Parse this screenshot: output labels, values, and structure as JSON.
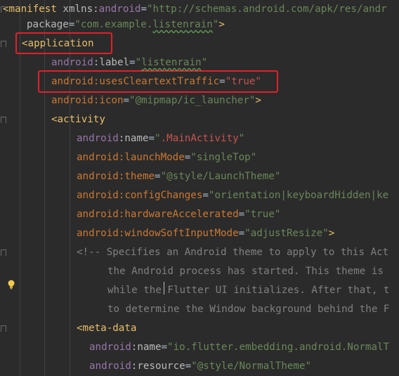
{
  "lines": [
    {
      "id": "l0",
      "parts": [
        [
          "tag",
          "<manifest "
        ],
        [
          "attr",
          "xmlns:"
        ],
        [
          "ns",
          "android"
        ],
        [
          "plain",
          "="
        ],
        [
          "val",
          "\"http://schemas.android.com/apk/res/andr"
        ]
      ]
    },
    {
      "id": "l1",
      "parts": [
        [
          "attr",
          "package"
        ],
        [
          "plain",
          "="
        ],
        [
          "val",
          "\"com.example."
        ],
        [
          "valu",
          "listenrain"
        ],
        [
          "val",
          "\""
        ],
        [
          "tag",
          ">"
        ]
      ]
    },
    {
      "id": "l2",
      "parts": [
        [
          "tag",
          "<application"
        ]
      ]
    },
    {
      "id": "l3",
      "parts": [
        [
          "ns",
          "android"
        ],
        [
          "attr",
          ":label"
        ],
        [
          "plain",
          "="
        ],
        [
          "val",
          "\""
        ],
        [
          "valu",
          "listenrain"
        ],
        [
          "val",
          "\""
        ]
      ]
    },
    {
      "id": "l4",
      "parts": [
        [
          "attrr",
          "android:usesCleartextTraffic"
        ],
        [
          "plain",
          "="
        ],
        [
          "valr",
          "\"true\""
        ]
      ]
    },
    {
      "id": "l5",
      "parts": [
        [
          "attrr",
          "android:icon"
        ],
        [
          "plain",
          "="
        ],
        [
          "val",
          "\"@mipmap/ic_launcher\""
        ],
        [
          "tag",
          ">"
        ]
      ]
    },
    {
      "id": "l6",
      "parts": [
        [
          "tag",
          "<activity"
        ]
      ]
    },
    {
      "id": "l7",
      "parts": [
        [
          "ns",
          "android"
        ],
        [
          "attr",
          ":name"
        ],
        [
          "plain",
          "="
        ],
        [
          "val",
          "\""
        ],
        [
          "valr",
          ".MainActivity"
        ],
        [
          "val",
          "\""
        ]
      ]
    },
    {
      "id": "l8",
      "parts": [
        [
          "attrr",
          "android:launchMode"
        ],
        [
          "plain",
          "="
        ],
        [
          "val",
          "\"singleTop\""
        ]
      ]
    },
    {
      "id": "l9",
      "parts": [
        [
          "attrr",
          "android:theme"
        ],
        [
          "plain",
          "="
        ],
        [
          "val",
          "\"@style/LaunchTheme\""
        ]
      ]
    },
    {
      "id": "l10",
      "parts": [
        [
          "attrr",
          "android:configChanges"
        ],
        [
          "plain",
          "="
        ],
        [
          "val",
          "\"orientation|keyboardHidden|ke"
        ]
      ]
    },
    {
      "id": "l11",
      "parts": [
        [
          "attrr",
          "android:hardwareAccelerated"
        ],
        [
          "plain",
          "="
        ],
        [
          "val",
          "\"true\""
        ]
      ]
    },
    {
      "id": "l12",
      "parts": [
        [
          "attrr",
          "android:windowSoftInputMode"
        ],
        [
          "plain",
          "="
        ],
        [
          "val",
          "\"adjustResize\""
        ],
        [
          "tag",
          ">"
        ]
      ]
    },
    {
      "id": "l13",
      "parts": [
        [
          "comment",
          "<!-- Specifies an Android theme to apply to this Act"
        ]
      ]
    },
    {
      "id": "l14",
      "parts": [
        [
          "comment",
          "the Android process has started. This theme is"
        ]
      ]
    },
    {
      "id": "l15",
      "parts": [
        [
          "comment",
          "while the"
        ],
        [
          "comment",
          " Flutter UI initializes. After that, t"
        ]
      ]
    },
    {
      "id": "l16",
      "parts": [
        [
          "comment",
          "to determine the Window background behind the F"
        ]
      ]
    },
    {
      "id": "l17",
      "parts": [
        [
          "tag",
          "<meta-data"
        ]
      ]
    },
    {
      "id": "l18",
      "parts": [
        [
          "ns",
          "android"
        ],
        [
          "attr",
          ":name"
        ],
        [
          "plain",
          "="
        ],
        [
          "val",
          "\"io.flutter.embedding.android.NormalT"
        ]
      ]
    },
    {
      "id": "l19",
      "parts": [
        [
          "ns",
          "android"
        ],
        [
          "attr",
          ":resource"
        ],
        [
          "plain",
          "="
        ],
        [
          "val",
          "\"@style/NormalTheme\""
        ]
      ]
    }
  ],
  "highlight_color": "#e0202a",
  "icons": {
    "bulb": "lightbulb-icon"
  }
}
